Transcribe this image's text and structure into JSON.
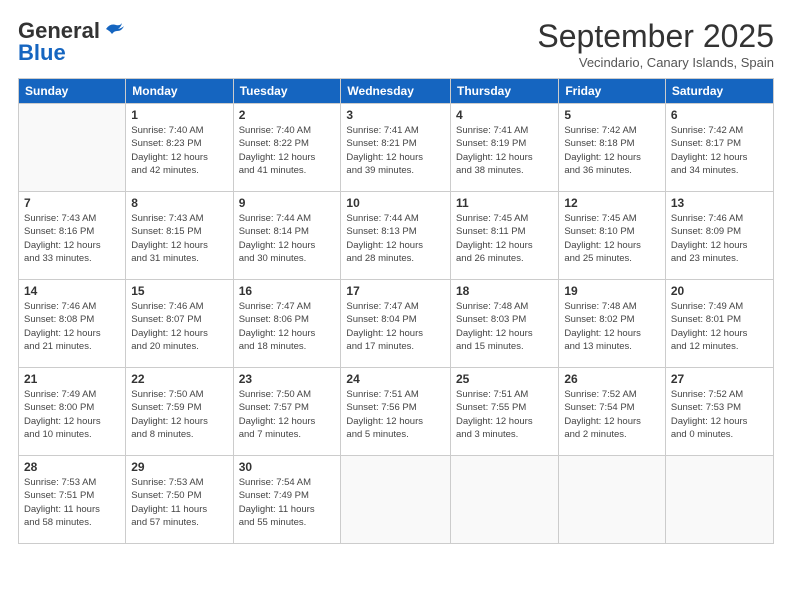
{
  "header": {
    "logo_general": "General",
    "logo_blue": "Blue",
    "month": "September 2025",
    "location": "Vecindario, Canary Islands, Spain"
  },
  "days_of_week": [
    "Sunday",
    "Monday",
    "Tuesday",
    "Wednesday",
    "Thursday",
    "Friday",
    "Saturday"
  ],
  "weeks": [
    [
      {
        "day": "",
        "info": ""
      },
      {
        "day": "1",
        "info": "Sunrise: 7:40 AM\nSunset: 8:23 PM\nDaylight: 12 hours\nand 42 minutes."
      },
      {
        "day": "2",
        "info": "Sunrise: 7:40 AM\nSunset: 8:22 PM\nDaylight: 12 hours\nand 41 minutes."
      },
      {
        "day": "3",
        "info": "Sunrise: 7:41 AM\nSunset: 8:21 PM\nDaylight: 12 hours\nand 39 minutes."
      },
      {
        "day": "4",
        "info": "Sunrise: 7:41 AM\nSunset: 8:19 PM\nDaylight: 12 hours\nand 38 minutes."
      },
      {
        "day": "5",
        "info": "Sunrise: 7:42 AM\nSunset: 8:18 PM\nDaylight: 12 hours\nand 36 minutes."
      },
      {
        "day": "6",
        "info": "Sunrise: 7:42 AM\nSunset: 8:17 PM\nDaylight: 12 hours\nand 34 minutes."
      }
    ],
    [
      {
        "day": "7",
        "info": "Sunrise: 7:43 AM\nSunset: 8:16 PM\nDaylight: 12 hours\nand 33 minutes."
      },
      {
        "day": "8",
        "info": "Sunrise: 7:43 AM\nSunset: 8:15 PM\nDaylight: 12 hours\nand 31 minutes."
      },
      {
        "day": "9",
        "info": "Sunrise: 7:44 AM\nSunset: 8:14 PM\nDaylight: 12 hours\nand 30 minutes."
      },
      {
        "day": "10",
        "info": "Sunrise: 7:44 AM\nSunset: 8:13 PM\nDaylight: 12 hours\nand 28 minutes."
      },
      {
        "day": "11",
        "info": "Sunrise: 7:45 AM\nSunset: 8:11 PM\nDaylight: 12 hours\nand 26 minutes."
      },
      {
        "day": "12",
        "info": "Sunrise: 7:45 AM\nSunset: 8:10 PM\nDaylight: 12 hours\nand 25 minutes."
      },
      {
        "day": "13",
        "info": "Sunrise: 7:46 AM\nSunset: 8:09 PM\nDaylight: 12 hours\nand 23 minutes."
      }
    ],
    [
      {
        "day": "14",
        "info": "Sunrise: 7:46 AM\nSunset: 8:08 PM\nDaylight: 12 hours\nand 21 minutes."
      },
      {
        "day": "15",
        "info": "Sunrise: 7:46 AM\nSunset: 8:07 PM\nDaylight: 12 hours\nand 20 minutes."
      },
      {
        "day": "16",
        "info": "Sunrise: 7:47 AM\nSunset: 8:06 PM\nDaylight: 12 hours\nand 18 minutes."
      },
      {
        "day": "17",
        "info": "Sunrise: 7:47 AM\nSunset: 8:04 PM\nDaylight: 12 hours\nand 17 minutes."
      },
      {
        "day": "18",
        "info": "Sunrise: 7:48 AM\nSunset: 8:03 PM\nDaylight: 12 hours\nand 15 minutes."
      },
      {
        "day": "19",
        "info": "Sunrise: 7:48 AM\nSunset: 8:02 PM\nDaylight: 12 hours\nand 13 minutes."
      },
      {
        "day": "20",
        "info": "Sunrise: 7:49 AM\nSunset: 8:01 PM\nDaylight: 12 hours\nand 12 minutes."
      }
    ],
    [
      {
        "day": "21",
        "info": "Sunrise: 7:49 AM\nSunset: 8:00 PM\nDaylight: 12 hours\nand 10 minutes."
      },
      {
        "day": "22",
        "info": "Sunrise: 7:50 AM\nSunset: 7:59 PM\nDaylight: 12 hours\nand 8 minutes."
      },
      {
        "day": "23",
        "info": "Sunrise: 7:50 AM\nSunset: 7:57 PM\nDaylight: 12 hours\nand 7 minutes."
      },
      {
        "day": "24",
        "info": "Sunrise: 7:51 AM\nSunset: 7:56 PM\nDaylight: 12 hours\nand 5 minutes."
      },
      {
        "day": "25",
        "info": "Sunrise: 7:51 AM\nSunset: 7:55 PM\nDaylight: 12 hours\nand 3 minutes."
      },
      {
        "day": "26",
        "info": "Sunrise: 7:52 AM\nSunset: 7:54 PM\nDaylight: 12 hours\nand 2 minutes."
      },
      {
        "day": "27",
        "info": "Sunrise: 7:52 AM\nSunset: 7:53 PM\nDaylight: 12 hours\nand 0 minutes."
      }
    ],
    [
      {
        "day": "28",
        "info": "Sunrise: 7:53 AM\nSunset: 7:51 PM\nDaylight: 11 hours\nand 58 minutes."
      },
      {
        "day": "29",
        "info": "Sunrise: 7:53 AM\nSunset: 7:50 PM\nDaylight: 11 hours\nand 57 minutes."
      },
      {
        "day": "30",
        "info": "Sunrise: 7:54 AM\nSunset: 7:49 PM\nDaylight: 11 hours\nand 55 minutes."
      },
      {
        "day": "",
        "info": ""
      },
      {
        "day": "",
        "info": ""
      },
      {
        "day": "",
        "info": ""
      },
      {
        "day": "",
        "info": ""
      }
    ]
  ]
}
